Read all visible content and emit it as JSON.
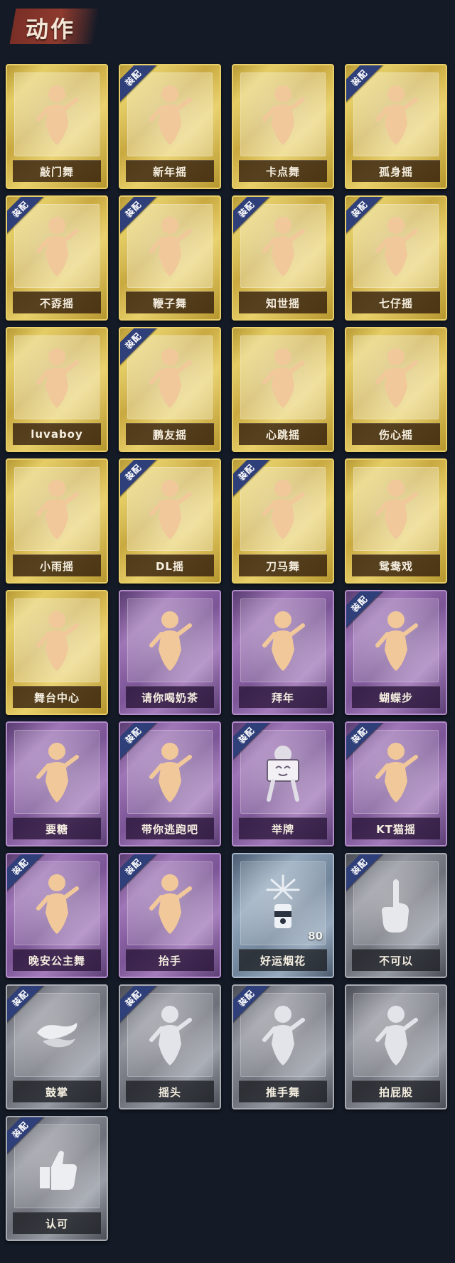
{
  "header": {
    "title": "动作"
  },
  "badge_text": "装配",
  "colors": {
    "gold": "#e4cb5e",
    "purple": "#9a6fb3",
    "blue": "#8ea3b8",
    "silver": "#8d9099",
    "badge": "#2f3f7a",
    "background": "#141a26"
  },
  "cards": [
    {
      "label": "敲门舞",
      "rarity": "gold",
      "equipped": false,
      "icon": "figure-icon"
    },
    {
      "label": "新年摇",
      "rarity": "gold",
      "equipped": true,
      "icon": "figure-icon"
    },
    {
      "label": "卡点舞",
      "rarity": "gold",
      "equipped": false,
      "icon": "figure-icon"
    },
    {
      "label": "孤身摇",
      "rarity": "gold",
      "equipped": true,
      "icon": "figure-icon"
    },
    {
      "label": "不孬摇",
      "rarity": "gold",
      "equipped": true,
      "icon": "figure-icon"
    },
    {
      "label": "鞭子舞",
      "rarity": "gold",
      "equipped": true,
      "icon": "figure-icon"
    },
    {
      "label": "知世摇",
      "rarity": "gold",
      "equipped": true,
      "icon": "figure-icon"
    },
    {
      "label": "七仔摇",
      "rarity": "gold",
      "equipped": true,
      "icon": "figure-icon"
    },
    {
      "label": "luvaboy",
      "rarity": "gold",
      "equipped": false,
      "icon": "figure-icon"
    },
    {
      "label": "鹏友摇",
      "rarity": "gold",
      "equipped": true,
      "icon": "figure-icon"
    },
    {
      "label": "心跳摇",
      "rarity": "gold",
      "equipped": false,
      "icon": "figure-icon"
    },
    {
      "label": "伤心摇",
      "rarity": "gold",
      "equipped": false,
      "icon": "figure-icon"
    },
    {
      "label": "小雨摇",
      "rarity": "gold",
      "equipped": false,
      "icon": "figure-icon"
    },
    {
      "label": "DL摇",
      "rarity": "gold",
      "equipped": true,
      "icon": "figure-icon"
    },
    {
      "label": "刀马舞",
      "rarity": "gold",
      "equipped": true,
      "icon": "figure-icon"
    },
    {
      "label": "鸳鸯戏",
      "rarity": "gold",
      "equipped": false,
      "icon": "figure-icon"
    },
    {
      "label": "舞台中心",
      "rarity": "gold",
      "equipped": false,
      "icon": "figure-icon"
    },
    {
      "label": "请你喝奶茶",
      "rarity": "purple",
      "equipped": false,
      "icon": "figure-icon"
    },
    {
      "label": "拜年",
      "rarity": "purple",
      "equipped": false,
      "icon": "figure-icon"
    },
    {
      "label": "蝴蝶步",
      "rarity": "purple",
      "equipped": true,
      "icon": "figure-icon"
    },
    {
      "label": "要糖",
      "rarity": "purple",
      "equipped": false,
      "icon": "figure-icon"
    },
    {
      "label": "带你逃跑吧",
      "rarity": "purple",
      "equipped": true,
      "icon": "figure-icon"
    },
    {
      "label": "举牌",
      "rarity": "purple",
      "equipped": true,
      "icon": "sign-icon"
    },
    {
      "label": "KT猫摇",
      "rarity": "purple",
      "equipped": true,
      "icon": "figure-icon"
    },
    {
      "label": "晚安公主舞",
      "rarity": "purple",
      "equipped": true,
      "icon": "figure-icon"
    },
    {
      "label": "抬手",
      "rarity": "purple",
      "equipped": true,
      "icon": "figure-icon"
    },
    {
      "label": "好运烟花",
      "rarity": "blue",
      "equipped": false,
      "icon": "firework-icon",
      "count": "80"
    },
    {
      "label": "不可以",
      "rarity": "silver",
      "equipped": true,
      "icon": "finger-icon"
    },
    {
      "label": "鼓掌",
      "rarity": "silver",
      "equipped": true,
      "icon": "clap-icon"
    },
    {
      "label": "摇头",
      "rarity": "silver",
      "equipped": true,
      "icon": "figure-icon"
    },
    {
      "label": "推手舞",
      "rarity": "silver",
      "equipped": true,
      "icon": "figure-icon"
    },
    {
      "label": "拍屁股",
      "rarity": "silver",
      "equipped": false,
      "icon": "figure-icon"
    },
    {
      "label": "认可",
      "rarity": "silver",
      "equipped": true,
      "icon": "thumbs-up-icon"
    }
  ]
}
